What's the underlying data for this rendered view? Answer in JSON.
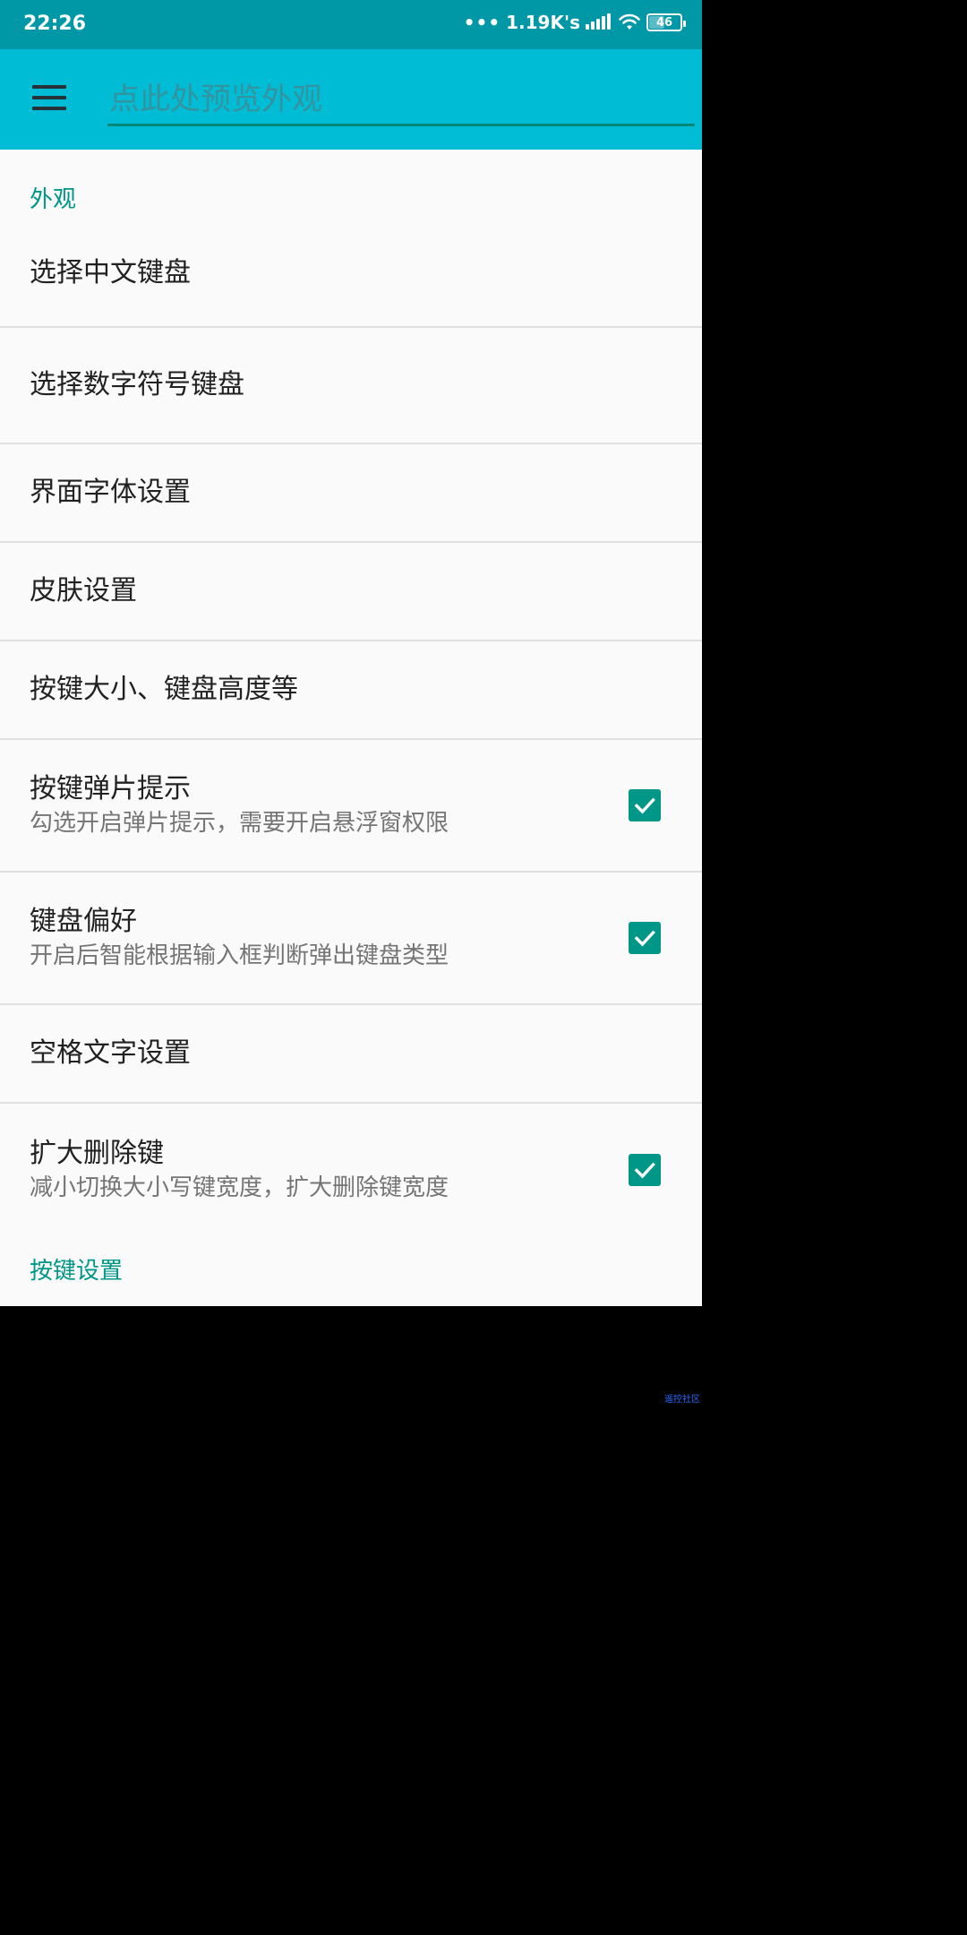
{
  "status_bar": {
    "time": "22:26",
    "network_speed": "1.19K's",
    "battery": "46",
    "bar_color": "#0097a7"
  },
  "toolbar": {
    "menu_icon": "hamburger-menu-icon",
    "search_placeholder": "点此处预览外观",
    "background": "#00bcd4",
    "accent": "#009688"
  },
  "sections": [
    {
      "header": "外观",
      "items": [
        {
          "title": "选择中文键盘"
        },
        {
          "title": "选择数字符号键盘"
        },
        {
          "title": "界面字体设置"
        },
        {
          "title": "皮肤设置"
        },
        {
          "title": "按键大小、键盘高度等"
        },
        {
          "title": "按键弹片提示",
          "summary": "勾选开启弹片提示，需要开启悬浮窗权限",
          "checked": true
        },
        {
          "title": "键盘偏好",
          "summary": "开启后智能根据输入框判断弹出键盘类型",
          "checked": true
        },
        {
          "title": "空格文字设置"
        },
        {
          "title": "扩大删除键",
          "summary": "减小切换大小写键宽度，扩大删除键宽度",
          "checked": true
        }
      ]
    },
    {
      "header": "按键设置"
    }
  ],
  "watermark": "遥控社区"
}
